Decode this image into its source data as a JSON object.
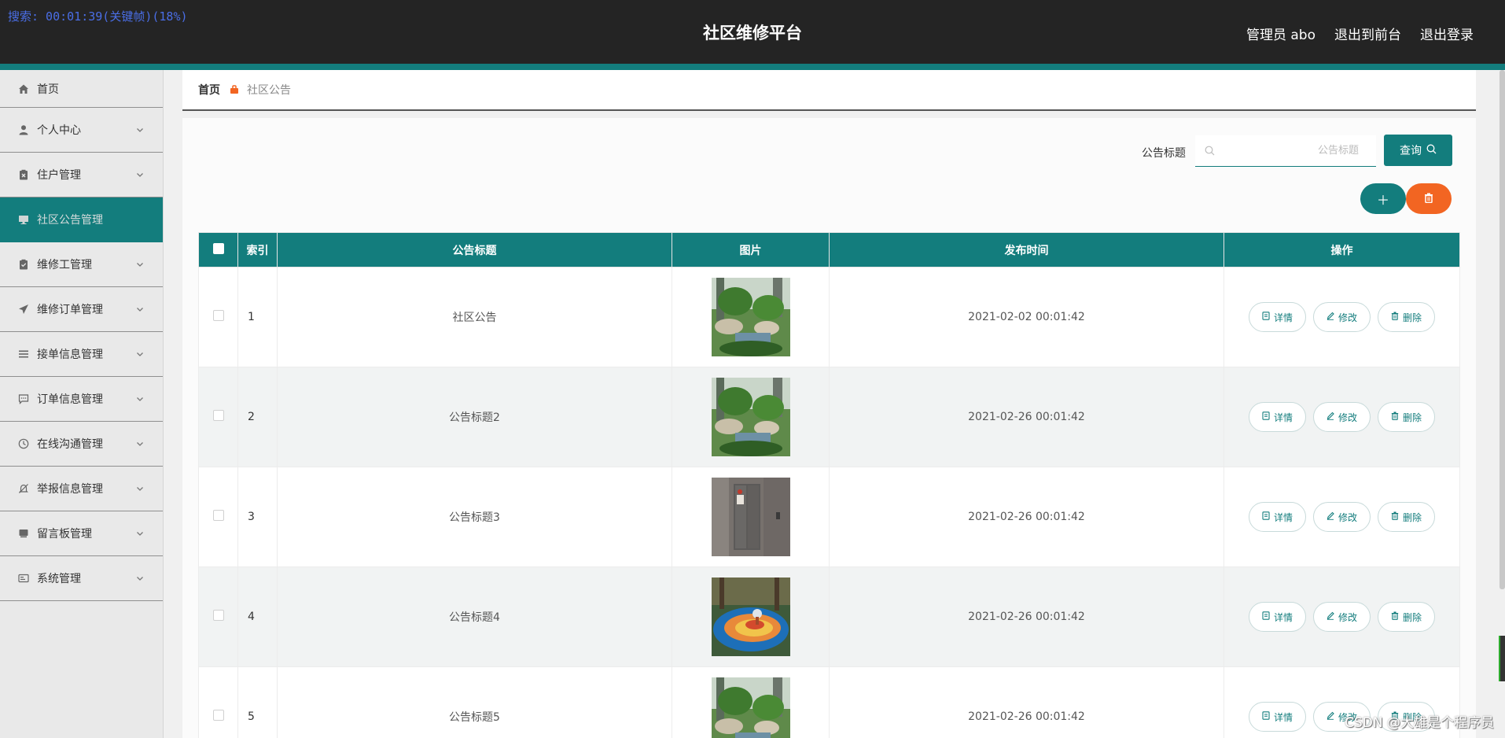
{
  "recording": {
    "text": "搜索: 00:01:39(关键帧)(18%)"
  },
  "header": {
    "title": "社区维修平台",
    "links": [
      "管理员 abo",
      "退出到前台",
      "退出登录"
    ]
  },
  "sidebar": {
    "items": [
      {
        "label": "首页",
        "icon": "home-icon",
        "chevron": false,
        "active": false
      },
      {
        "label": "个人中心",
        "icon": "user-icon",
        "chevron": true,
        "active": false
      },
      {
        "label": "住户管理",
        "icon": "clipboard-x-icon",
        "chevron": true,
        "active": false
      },
      {
        "label": "社区公告管理",
        "icon": "monitor-icon",
        "chevron": false,
        "active": true
      },
      {
        "label": "维修工管理",
        "icon": "clipboard-icon",
        "chevron": true,
        "active": false
      },
      {
        "label": "维修订单管理",
        "icon": "send-icon",
        "chevron": true,
        "active": false
      },
      {
        "label": "接单信息管理",
        "icon": "list-icon",
        "chevron": true,
        "active": false
      },
      {
        "label": "订单信息管理",
        "icon": "chat-icon",
        "chevron": true,
        "active": false
      },
      {
        "label": "在线沟通管理",
        "icon": "clock-icon",
        "chevron": true,
        "active": false
      },
      {
        "label": "举报信息管理",
        "icon": "bell-off-icon",
        "chevron": true,
        "active": false
      },
      {
        "label": "留言板管理",
        "icon": "folder-icon",
        "chevron": true,
        "active": false
      },
      {
        "label": "系统管理",
        "icon": "card-icon",
        "chevron": true,
        "active": false
      }
    ]
  },
  "breadcrumb": {
    "home": "首页",
    "current": "社区公告"
  },
  "search": {
    "label": "公告标题",
    "placeholder": "公告标题",
    "value": "",
    "button": "查询"
  },
  "table": {
    "headers": [
      "索引",
      "公告标题",
      "图片",
      "发布时间",
      "操作"
    ],
    "rows": [
      {
        "index": "1",
        "title": "社区公告",
        "image": "garden",
        "time": "2021-02-02 00:01:42"
      },
      {
        "index": "2",
        "title": "公告标题2",
        "image": "garden",
        "time": "2021-02-26 00:01:42"
      },
      {
        "index": "3",
        "title": "公告标题3",
        "image": "elevator",
        "time": "2021-02-26 00:01:42"
      },
      {
        "index": "4",
        "title": "公告标题4",
        "image": "playground",
        "time": "2021-02-26 00:01:42"
      },
      {
        "index": "5",
        "title": "公告标题5",
        "image": "garden",
        "time": "2021-02-26 00:01:42"
      }
    ],
    "actions": {
      "detail": "详情",
      "edit": "修改",
      "delete": "删除"
    }
  },
  "watermark": "CSDN @大雄是个程序员",
  "colors": {
    "primary": "#137d7d",
    "danger": "#f26522",
    "header": "#242424"
  }
}
